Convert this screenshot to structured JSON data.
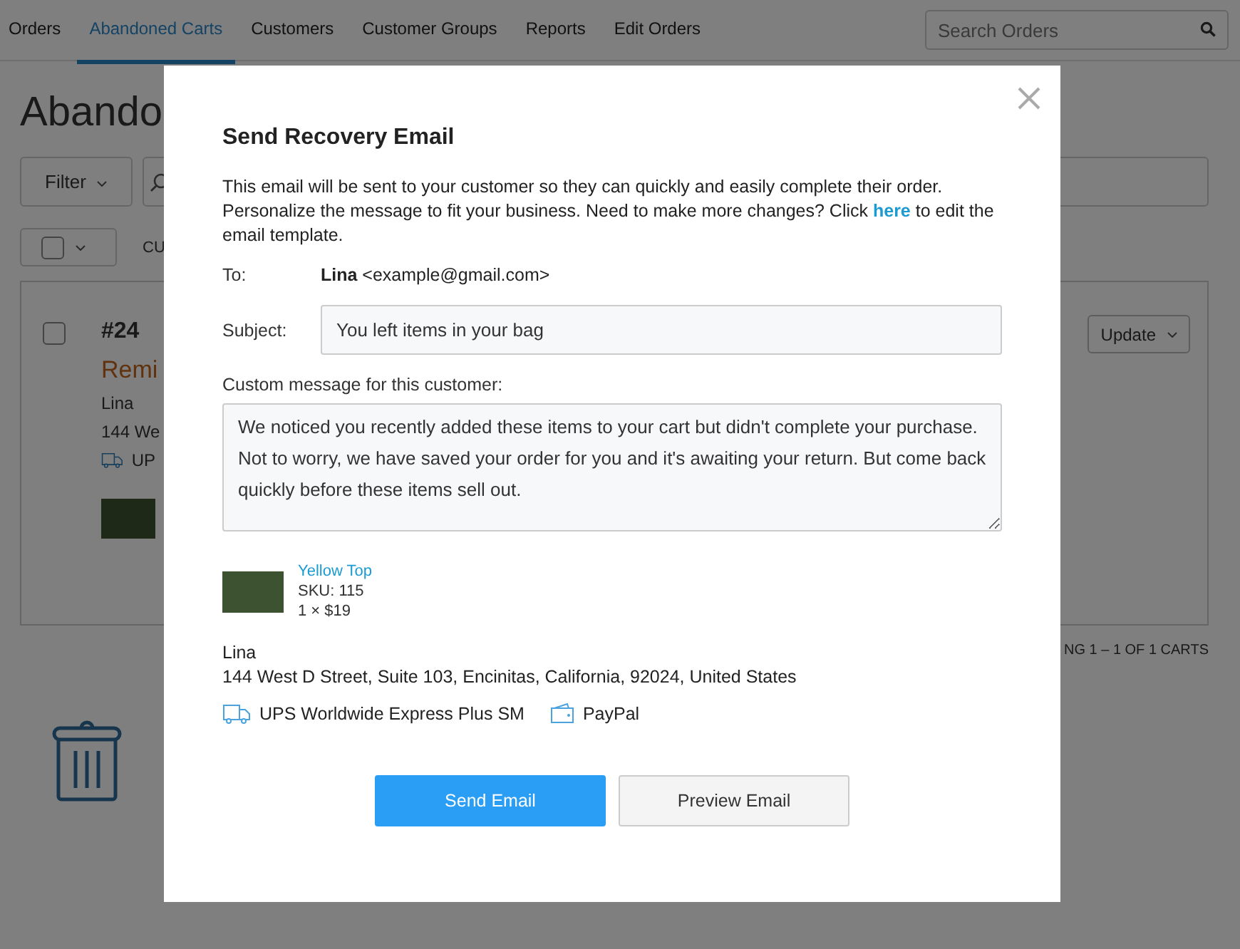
{
  "nav": {
    "tabs": [
      {
        "label": "Orders",
        "selected": false
      },
      {
        "label": "Abandoned Carts",
        "selected": true
      },
      {
        "label": "Customers",
        "selected": false
      },
      {
        "label": "Customer Groups",
        "selected": false
      },
      {
        "label": "Reports",
        "selected": false
      },
      {
        "label": "Edit Orders",
        "selected": false
      }
    ],
    "search": {
      "placeholder": "Search Orders"
    }
  },
  "page": {
    "title": "Abando",
    "filter_button": "Filter",
    "select_all": {
      "checked": false
    },
    "column_1": "CU",
    "card": {
      "checked": false,
      "number": "#24",
      "status": "Remi",
      "customer": "Lina",
      "address": "144 We",
      "shipping": "UP",
      "update_button": "Update"
    },
    "pagination": "NG 1 – 1 OF 1 CARTS"
  },
  "modal": {
    "title": "Send Recovery Email",
    "intro_before": "This email will be sent to your customer so they can quickly and easily complete their order. Personalize the message to fit your business. Need to make more changes? Click ",
    "intro_link": "here",
    "intro_after": " to edit the email template.",
    "to_label": "To:",
    "to_name": "Lina",
    "to_email": "<example@gmail.com>",
    "subject_label": "Subject:",
    "subject_value": "You left items in your bag",
    "message_label": "Custom message for this customer:",
    "message_value": "We noticed you recently added these items to your cart but didn't complete your purchase. Not to worry, we have saved your order for you and it's awaiting your return. But come back quickly before these items sell out.",
    "item": {
      "name": "Yellow Top",
      "sku": "SKU: 115",
      "qty_price": "1 × $19"
    },
    "customer": "Lina",
    "address": "144 West D Street, Suite 103, Encinitas, California, 92024, United States",
    "shipping": "UPS Worldwide Express Plus SM",
    "payment": "PayPal",
    "buttons": [
      {
        "label": "Send Email",
        "kind": "primary"
      },
      {
        "label": "Preview Email",
        "kind": "secondary"
      }
    ]
  }
}
